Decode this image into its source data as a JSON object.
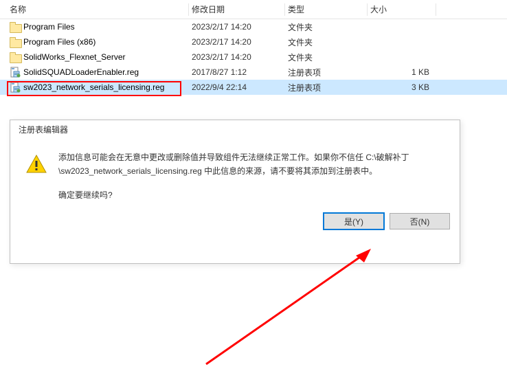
{
  "header": {
    "name": "名称",
    "date": "修改日期",
    "type": "类型",
    "size": "大小"
  },
  "rows": [
    {
      "icon": "folder",
      "name": "Program Files",
      "date": "2023/2/17 14:20",
      "type": "文件夹",
      "size": ""
    },
    {
      "icon": "folder",
      "name": "Program Files (x86)",
      "date": "2023/2/17 14:20",
      "type": "文件夹",
      "size": ""
    },
    {
      "icon": "folder",
      "name": "SolidWorks_Flexnet_Server",
      "date": "2023/2/17 14:20",
      "type": "文件夹",
      "size": ""
    },
    {
      "icon": "reg",
      "name": "SolidSQUADLoaderEnabler.reg",
      "date": "2017/8/27 1:12",
      "type": "注册表项",
      "size": "1 KB"
    },
    {
      "icon": "reg",
      "name": "sw2023_network_serials_licensing.reg",
      "date": "2022/9/4 22:14",
      "type": "注册表项",
      "size": "3 KB",
      "selected": true
    }
  ],
  "dialog": {
    "title": "注册表编辑器",
    "message": "添加信息可能会在无意中更改或删除值并导致组件无法继续正常工作。如果你不信任 C:\\破解补丁\\sw2023_network_serials_licensing.reg 中此信息的来源，请不要将其添加到注册表中。",
    "confirm": "确定要继续吗?",
    "yes": "是(Y)",
    "no": "否(N)"
  }
}
